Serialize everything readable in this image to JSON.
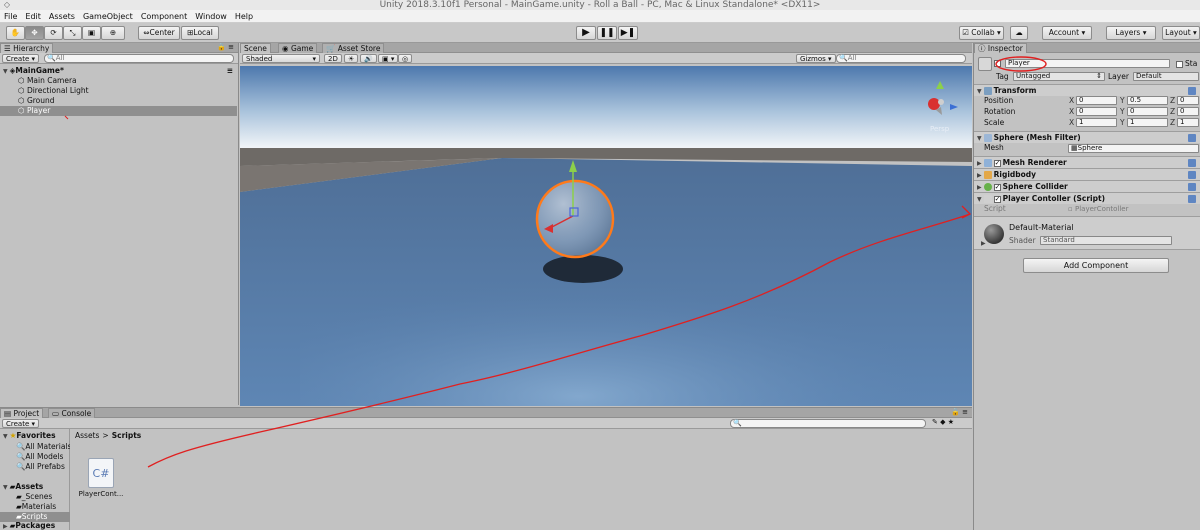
{
  "window": {
    "title": "Unity 2018.3.10f1 Personal - MainGame.unity - Roll a Ball - PC, Mac & Linux Standalone* <DX11>"
  },
  "menu": [
    "File",
    "Edit",
    "Assets",
    "GameObject",
    "Component",
    "Window",
    "Help"
  ],
  "toolbar": {
    "tools": [
      "hand-icon",
      "move-icon",
      "rotate-icon",
      "scale-icon",
      "rect-icon",
      "transform-icon"
    ],
    "pivot": "Center",
    "space": "Local",
    "play_icons": [
      "play-icon",
      "pause-icon",
      "step-icon"
    ],
    "collab": "Collab",
    "account": "Account",
    "layers": "Layers",
    "layout": "Layout"
  },
  "hierarchy": {
    "tab": "Hierarchy",
    "create": "Create",
    "search_placeholder": "All",
    "scene": "MainGame*",
    "items": [
      "Main Camera",
      "Directional Light",
      "Ground",
      "Player"
    ],
    "selected": "Player"
  },
  "scene_view": {
    "tabs": [
      "Scene",
      "Game",
      "Asset Store"
    ],
    "shading": "Shaded",
    "mode_2d": "2D",
    "gizmos": "Gizmos",
    "search_placeholder": "All",
    "gizmo_label": "Persp"
  },
  "inspector": {
    "tab": "Inspector",
    "object_name": "Player",
    "static_label": "Sta",
    "tag_label": "Tag",
    "tag": "Untagged",
    "layer_label": "Layer",
    "layer": "Default",
    "transform": {
      "title": "Transform",
      "position_label": "Position",
      "rotation_label": "Rotation",
      "scale_label": "Scale",
      "position": [
        "0",
        "0.5",
        "0"
      ],
      "rotation": [
        "0",
        "0",
        "0"
      ],
      "scale": [
        "1",
        "1",
        "1"
      ],
      "axes": [
        "X",
        "Y",
        "Z"
      ]
    },
    "mesh_filter": {
      "title": "Sphere (Mesh Filter)",
      "mesh_label": "Mesh",
      "mesh": "Sphere"
    },
    "mesh_renderer": {
      "title": "Mesh Renderer"
    },
    "rigidbody": {
      "title": "Rigidbody"
    },
    "sphere_collider": {
      "title": "Sphere Collider"
    },
    "script_comp": {
      "title": "Player Contoller (Script)",
      "script_label": "Script",
      "script": "PlayerContoller"
    },
    "material": {
      "name": "Default-Material",
      "shader_label": "Shader",
      "shader": "Standard"
    },
    "add_component": "Add Component"
  },
  "project": {
    "tabs": [
      "Project",
      "Console"
    ],
    "create": "Create",
    "favorites_title": "Favorites",
    "favorites": [
      "All Materials",
      "All Models",
      "All Prefabs"
    ],
    "assets_title": "Assets",
    "assets": [
      "_Scenes",
      "Materials",
      "Scripts"
    ],
    "packages": "Packages",
    "breadcrumb": [
      "Assets",
      "Scripts"
    ],
    "file_icon_text": "C#",
    "file_name": "PlayerCont..."
  },
  "colors": {
    "annotation": "#e02020",
    "selection": "#ff7a1a"
  }
}
